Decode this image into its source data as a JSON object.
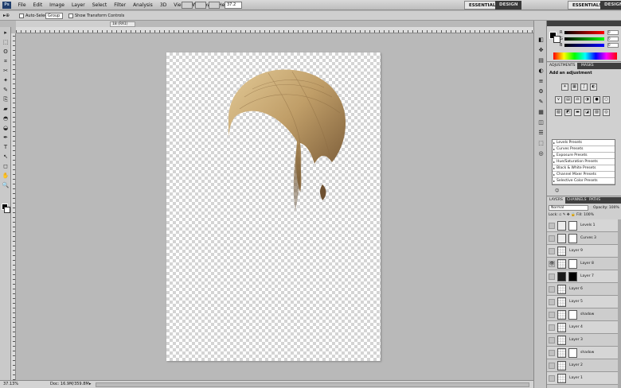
{
  "app": {
    "logo": "Ps"
  },
  "menu": [
    "File",
    "Edit",
    "Image",
    "Layer",
    "Select",
    "Filter",
    "Analysis",
    "3D",
    "View",
    "Window",
    "Help"
  ],
  "zoom_field": "37.2",
  "workspace": {
    "essentials": "ESSENTIALS",
    "design": "DESIGN"
  },
  "options": {
    "tool": "▸⊕",
    "auto_select": "Auto-Select:",
    "auto_select_value": "Group",
    "transform_label": "Show Transform Controls"
  },
  "doc_tab": "18 (RA1)",
  "status": {
    "zoom": "37.13%",
    "doc": "Doc: 16.9M/359.8M",
    "arrow": "▸"
  },
  "adjustments": {
    "tabs": [
      "ADJUSTMENTS",
      "MASKS"
    ],
    "title": "Add an adjustment",
    "row1": [
      "☀",
      "▦",
      "∫",
      "◐"
    ],
    "row2": [
      "∨",
      "▤",
      "⚖",
      "◑",
      "●",
      "○"
    ],
    "row3": [
      "▧",
      "◩",
      "▬",
      "◪",
      "▨",
      "◎"
    ],
    "presets": [
      "Levels Presets",
      "Curves Presets",
      "Exposure Presets",
      "Hue/Saturation Presets",
      "Black & White Presets",
      "Channel Mixer Presets",
      "Selective Color Presets"
    ],
    "footer": "☺"
  },
  "color": {
    "sliders": [
      {
        "label": "R",
        "value": "0"
      },
      {
        "label": "G",
        "value": "0"
      },
      {
        "label": "B",
        "value": "0"
      }
    ]
  },
  "layers": {
    "tabs": [
      "LAYERS",
      "CHANNELS",
      "PATHS"
    ],
    "blend": "Normal",
    "opacity": "Opacity: 100%",
    "lock": "Lock: ▫ ✎ ✥ 🔒   Fill: 100%",
    "items": [
      {
        "name": "Levels 1",
        "type": "adj"
      },
      {
        "name": "Curves 3",
        "type": "adj"
      },
      {
        "name": "Layer 9",
        "type": "normal"
      },
      {
        "name": "Layer 8",
        "type": "mask"
      },
      {
        "name": "Layer 7",
        "type": "dark"
      },
      {
        "name": "Layer 6",
        "type": "normal"
      },
      {
        "name": "Layer 5",
        "type": "normal"
      },
      {
        "name": "shadow",
        "type": "mask"
      },
      {
        "name": "Layer 4",
        "type": "normal"
      },
      {
        "name": "Layer 3",
        "type": "normal"
      },
      {
        "name": "shadow",
        "type": "mask"
      },
      {
        "name": "Layer 2",
        "type": "normal"
      },
      {
        "name": "Layer 1",
        "type": "normal"
      }
    ]
  },
  "icons": {
    "eye": "👁",
    "tools": [
      "▸",
      "⬚",
      "ʘ",
      "⌗",
      "✂",
      "✦",
      "✎",
      "⎘",
      "▰",
      "◓",
      "◒",
      "✒",
      "T",
      "↖",
      "◻",
      "✋",
      "🔍"
    ]
  }
}
